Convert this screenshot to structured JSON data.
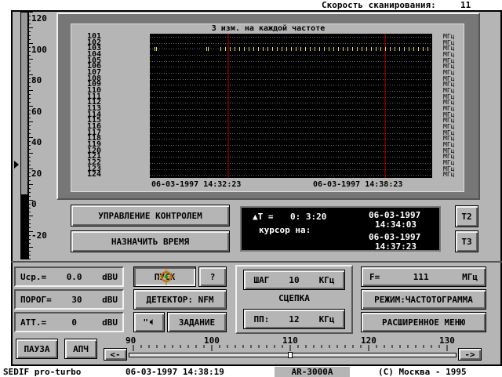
{
  "topbar": {
    "scan_speed_label": "Скорость сканирования:",
    "scan_speed_value": "11"
  },
  "meter": {
    "ticks": [
      "120",
      "100",
      "80",
      "60",
      "40",
      "20",
      "0",
      "-20"
    ],
    "level_fraction": 0.26,
    "pointer_value": "40"
  },
  "spectrum": {
    "title": "3 изм. на каждой частоте",
    "freqs": [
      "101",
      "102",
      "103",
      "104",
      "105",
      "106",
      "107",
      "108",
      "109",
      "110",
      "111",
      "112",
      "113",
      "114",
      "115",
      "116",
      "117",
      "118",
      "119",
      "120",
      "121",
      "122",
      "123",
      "124"
    ],
    "unit": "МГц",
    "time_left": "06-03-1997 14:32:23",
    "time_right": "06-03-1997 14:38:23"
  },
  "controls": {
    "manage_label": "УПРАВЛЕНИЕ КОНТРОЛЕМ",
    "assign_time_label": "НАЗНАЧИТЬ ВРЕМЯ",
    "t2_label": "Т2",
    "t3_label": "Т3"
  },
  "info": {
    "delta_t_label": "▲Т =",
    "delta_t_value": "0: 3:20",
    "time1_date": "06-03-1997",
    "time1_clock": "14:34:03",
    "cursor_label": "курсор на:",
    "time2_date": "06-03-1997",
    "time2_clock": "14:37:23"
  },
  "fields": {
    "u_label": "Uср.=",
    "u_value": "0.0",
    "u_unit": "dBU",
    "threshold_label": "ПОРОГ=",
    "threshold_value": "30",
    "threshold_unit": "dBU",
    "att_label": "АТТ.=",
    "att_value": "0",
    "att_unit": "dBU"
  },
  "buttons": {
    "start": "ПУСК",
    "help": "?",
    "detector": "ДЕТЕКТОР: NFM",
    "sound_prefix": "\"",
    "task": "ЗАДАНИЕ",
    "pause": "ПАУЗА",
    "apch": "АПЧ"
  },
  "step": {
    "step_label": "ШАГ",
    "step_value": "10",
    "step_unit": "КГц",
    "link_label": "СЦЕПКА",
    "pp_label": "ПП:",
    "pp_value": "12",
    "pp_unit": "КГц"
  },
  "right": {
    "f_label": "F=",
    "f_value": "111",
    "f_unit": "МГц",
    "mode": "РЕЖИМ:ЧАСТОТОГРАММА",
    "ext_menu": "РАСШИРЕННОЕ МЕНЮ"
  },
  "scale": {
    "labels": [
      "90",
      "100",
      "110",
      "120",
      "130"
    ],
    "left_btn": "<-",
    "right_btn": "->",
    "position_fraction": 0.49
  },
  "status": {
    "program": "SEDIF pro-turbo",
    "datetime": "06-03-1997 14:38:19",
    "device": "AR-3000A",
    "copyright": "(C) Москва - 1995"
  }
}
